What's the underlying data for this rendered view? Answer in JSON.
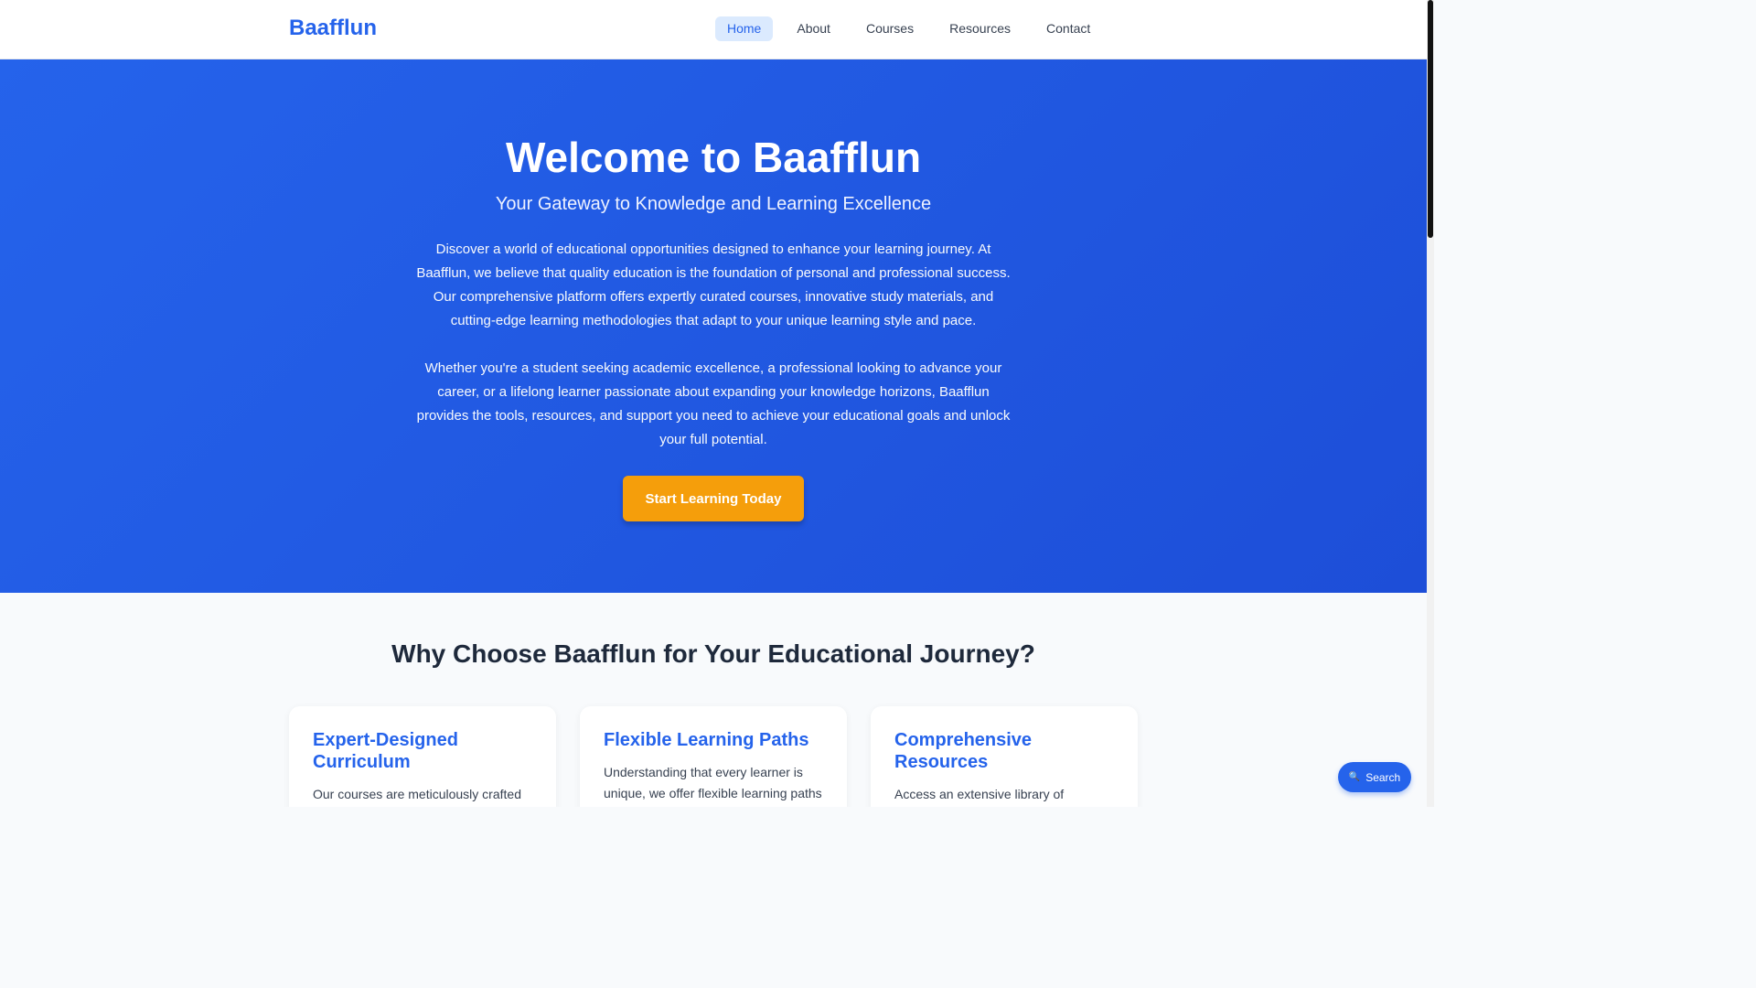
{
  "brand": {
    "name": "Baafflun"
  },
  "nav": {
    "items": [
      {
        "label": "Home"
      },
      {
        "label": "About"
      },
      {
        "label": "Courses"
      },
      {
        "label": "Resources"
      },
      {
        "label": "Contact"
      }
    ],
    "active": "Home"
  },
  "hero": {
    "title": "Welcome to Baafflun",
    "subtitle": "Your Gateway to Knowledge and Learning Excellence",
    "paragraphs": [
      "Discover a world of educational opportunities designed to enhance your learning journey. At Baafflun, we believe that quality education is the foundation of personal and professional success. Our comprehensive platform offers expertly curated courses, innovative study materials, and cutting-edge learning methodologies that adapt to your unique learning style and pace.",
      "Whether you're a student seeking academic excellence, a professional looking to advance your career, or a lifelong learner passionate about expanding your knowledge horizons, Baafflun provides the tools, resources, and support you need to achieve your educational goals and unlock your full potential."
    ],
    "cta_label": "Start Learning Today"
  },
  "features": {
    "title": "Why Choose Baafflun for Your Educational Journey?",
    "cards": [
      {
        "title": "Expert-Designed Curriculum",
        "text": "Our courses are meticulously crafted by"
      },
      {
        "title": "Flexible Learning Paths",
        "text": "Understanding that every learner is unique, we offer flexible learning paths"
      },
      {
        "title": "Comprehensive Resources",
        "text": "Access an extensive library of"
      }
    ]
  },
  "search_fab": {
    "icon": "search-icon",
    "label": "Search"
  },
  "colors": {
    "primary": "#2563eb",
    "accent": "#f59e0b",
    "nav_active_bg": "#dbeafe"
  }
}
